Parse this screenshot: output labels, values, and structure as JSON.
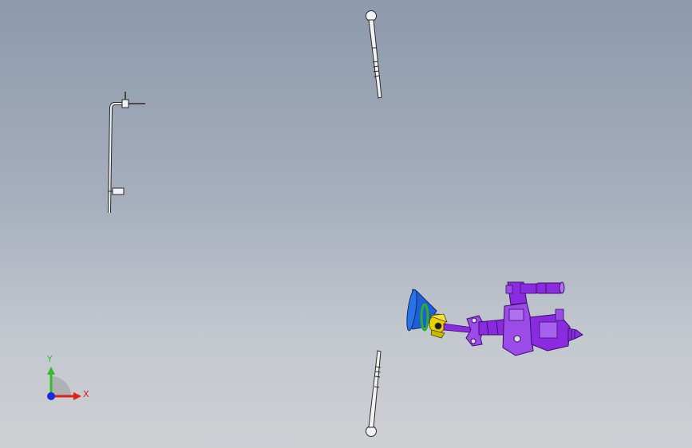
{
  "viewport": {
    "background_top": "#8d99ac",
    "background_bottom": "#cdd0d3"
  },
  "triad": {
    "x_label": "X",
    "y_label": "Y",
    "x_color": "#e0201a",
    "y_color": "#2fbf2a",
    "z_color": "#1a2ae0"
  },
  "parts": {
    "accent_purple": "#8a2be2",
    "accent_blue": "#1f5fd6",
    "accent_yellow": "#e6d200",
    "accent_green": "#2bb02b",
    "edge_color": "#2a2a2a",
    "body_color": "#f2f2f2"
  }
}
